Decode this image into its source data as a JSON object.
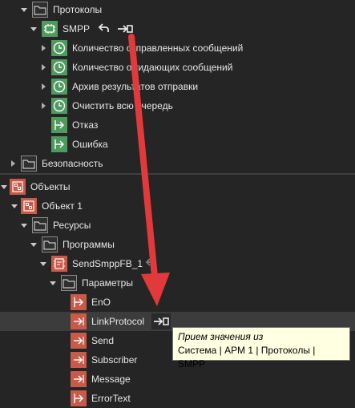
{
  "tree": {
    "protocols": "Протоколы",
    "smpp": "SMPP",
    "smpp_children": [
      "Количество отправленных сообщений",
      "Количество ожидающих сообщений",
      "Архив результатов отправки",
      "Очистить всю очередь",
      "Отказ",
      "Ошибка"
    ],
    "security": "Безопасность",
    "objects": "Объекты",
    "object1": "Объект 1",
    "resources": "Ресурсы",
    "programs": "Программы",
    "program_item": "SendSmppFB_1",
    "parameters": "Параметры",
    "params": [
      "EnO",
      "LinkProtocol",
      "Send",
      "Subscriber",
      "Message",
      "ErrorText"
    ]
  },
  "tooltip": {
    "line1": "Прием значения из",
    "line2": "Система | АРМ 1 | Протоколы | SMPP"
  },
  "colors": {
    "background": "#252526",
    "accent_green": "#4f9a5f",
    "accent_red": "#c85a4a",
    "arrow": "#e23a3a",
    "tooltip_bg": "#ffffe1"
  }
}
